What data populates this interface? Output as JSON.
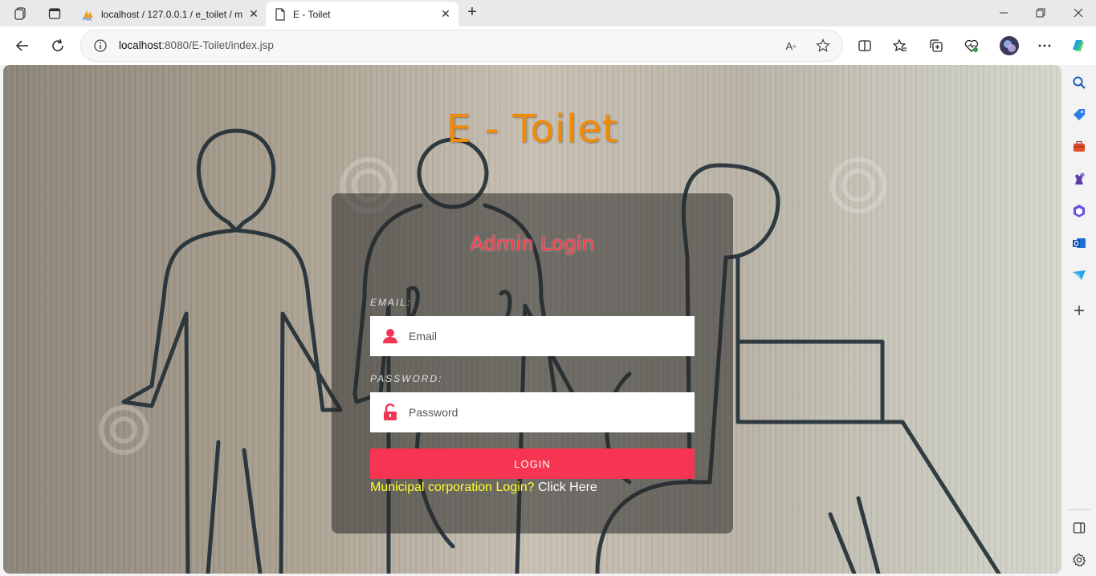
{
  "browser": {
    "tabs": [
      {
        "title": "localhost / 127.0.0.1 / e_toilet / m",
        "favicon": "phpmyadmin-icon",
        "active": false
      },
      {
        "title": "E - Toilet",
        "favicon": "page-icon",
        "active": true
      }
    ],
    "url_host": "localhost",
    "url_rest": ":8080/E-Toilet/index.jsp"
  },
  "page": {
    "title": "E - Toilet",
    "card_title": "Admin Login",
    "email_label": "EMAIL:",
    "email_placeholder": "Email",
    "password_label": "PASSWORD:",
    "password_placeholder": "Password",
    "login_button": "LOGIN",
    "municipal_question": "Municipal corporation Login?",
    "municipal_link": "Click Here"
  },
  "colors": {
    "title": "#f18a05",
    "card_title": "#ff3a4a",
    "login_button": "#f73451",
    "municipal_question": "#ffff2a"
  }
}
